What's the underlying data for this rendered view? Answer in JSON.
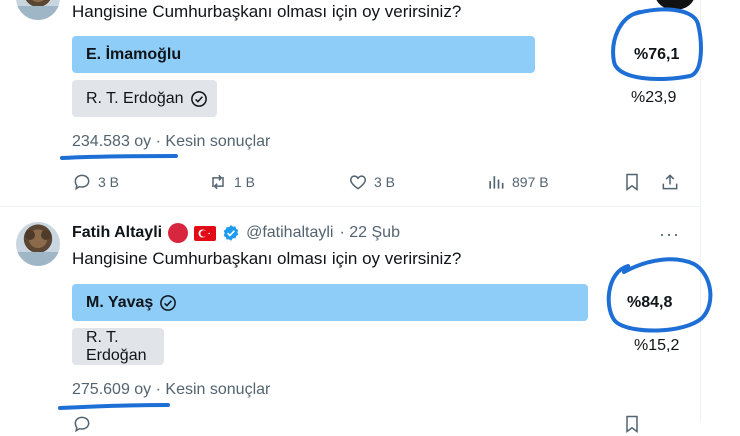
{
  "tweet1": {
    "question": "Hangisine Cumhurbaşkanı olması için oy verirsiniz?",
    "options": [
      {
        "label": "E. İmamoğlu",
        "percent": "%76,1",
        "fraction": 0.761,
        "winner": true
      },
      {
        "label": "R. T. Erdoğan",
        "percent": "%23,9",
        "fraction": 0.239,
        "winner": false
      }
    ],
    "votes": "234.583 oy",
    "status": "· Kesin sonuçlar",
    "actions": {
      "replies": "3 B",
      "retweets": "1 B",
      "likes": "3 B",
      "views": "897 B"
    }
  },
  "tweet2": {
    "author": "Fatih Altayli",
    "handle": "@fatihaltayli",
    "time": "· 22 Şub",
    "question": "Hangisine Cumhurbaşkanı olması için oy verirsiniz?",
    "options": [
      {
        "label": "M. Yavaş",
        "percent": "%84,8",
        "fraction": 0.848,
        "winner": true
      },
      {
        "label": "R. T. Erdoğan",
        "percent": "%15,2",
        "fraction": 0.152,
        "winner": false
      }
    ],
    "votes": "275.609 oy",
    "status": "· Kesin sonuçlar",
    "more": "···"
  },
  "colors": {
    "winner_bar": "#8ecdf8",
    "loser_bar": "#e1e4e8",
    "annotation": "#1d6fd6",
    "muted_text": "#536471"
  },
  "icons": [
    "reply-icon",
    "retweet-icon",
    "like-icon",
    "views-icon",
    "bookmark-icon",
    "share-icon",
    "verified-icon",
    "check-circle-icon"
  ]
}
